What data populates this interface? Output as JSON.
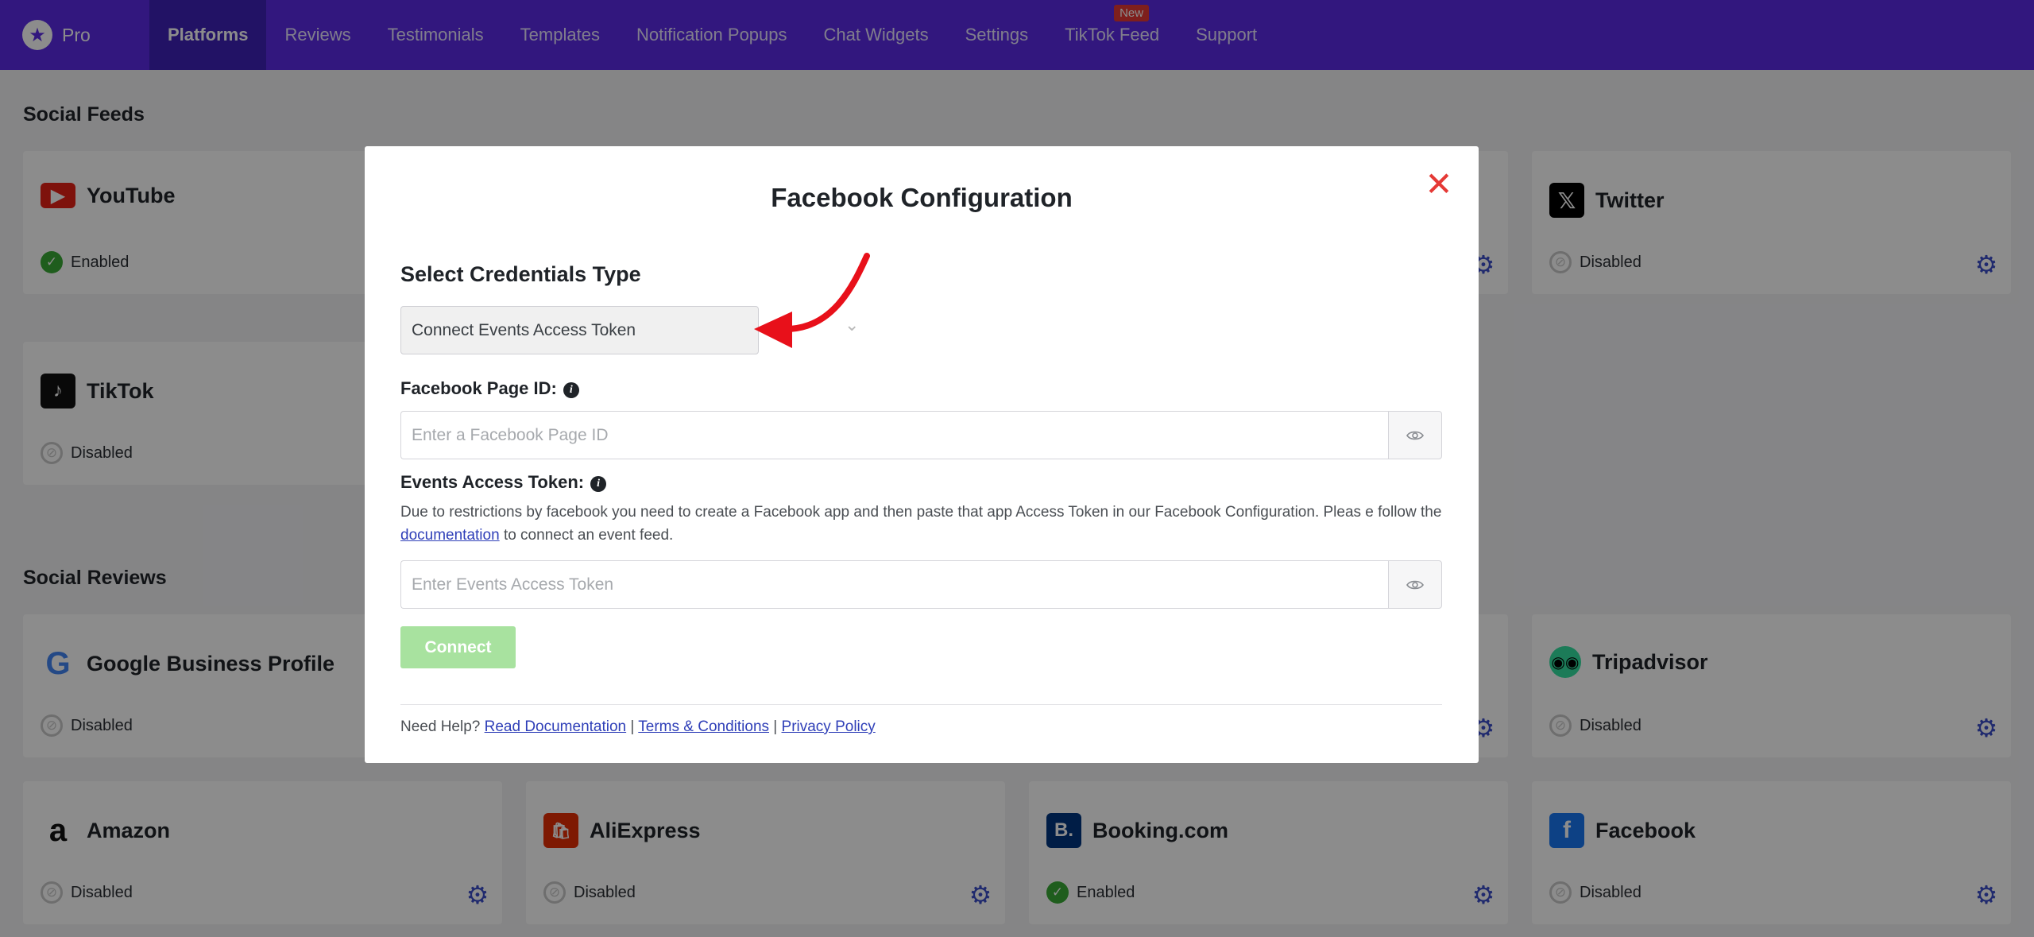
{
  "nav": {
    "brand": "Pro",
    "items": [
      {
        "label": "Platforms",
        "active": true
      },
      {
        "label": "Reviews"
      },
      {
        "label": "Testimonials"
      },
      {
        "label": "Templates"
      },
      {
        "label": "Notification Popups"
      },
      {
        "label": "Chat Widgets"
      },
      {
        "label": "Settings"
      },
      {
        "label": "TikTok Feed",
        "badge": "New"
      },
      {
        "label": "Support"
      }
    ]
  },
  "social_feeds": {
    "title": "Social Feeds",
    "cards": [
      {
        "name": "YouTube",
        "status": "Enabled",
        "icon": "youtube-icon"
      },
      {
        "name": "Twitter",
        "status": "Disabled",
        "icon": "x-twitter-icon"
      },
      {
        "name": "TikTok",
        "status": "Disabled",
        "icon": "tiktok-icon"
      }
    ]
  },
  "social_reviews": {
    "title": "Social Reviews",
    "cards": [
      {
        "name": "Google Business Profile",
        "status": "Disabled",
        "icon": "google-icon"
      },
      {
        "name": "Tripadvisor",
        "status": "Disabled",
        "icon": "tripadvisor-icon"
      },
      {
        "name": "Amazon",
        "status": "Disabled",
        "icon": "amazon-icon"
      },
      {
        "name": "AliExpress",
        "status": "Disabled",
        "icon": "aliexpress-icon"
      },
      {
        "name": "Booking.com",
        "status": "Enabled",
        "icon": "booking-icon"
      },
      {
        "name": "Facebook",
        "status": "Disabled",
        "icon": "facebook-icon"
      }
    ]
  },
  "modal": {
    "title": "Facebook Configuration",
    "credentials_label": "Select Credentials Type",
    "credentials_value": "Connect Events Access Token",
    "page_id_label": "Facebook Page ID:",
    "page_id_placeholder": "Enter a Facebook Page ID",
    "token_label": "Events Access Token:",
    "token_help_1": "Due to restrictions by facebook you need to create a Facebook app and then paste that app Access Token in our Facebook Configuration. Pleas e follow the",
    "token_help_link": "documentation",
    "token_help_2": "to connect an event feed.",
    "token_placeholder": "Enter Events Access Token",
    "connect_label": "Connect",
    "footer_prefix": "Need Help?",
    "footer_links": [
      "Read Documentation",
      "Terms & Conditions",
      "Privacy Policy"
    ],
    "footer_sep": "|"
  },
  "colors": {
    "nav_bg": "#5b2be6",
    "enabled": "#3aa935",
    "close": "#e53935",
    "connect_disabled": "#a8e29f",
    "gear": "#3b4ec8",
    "annotation_arrow": "#e8101a"
  }
}
